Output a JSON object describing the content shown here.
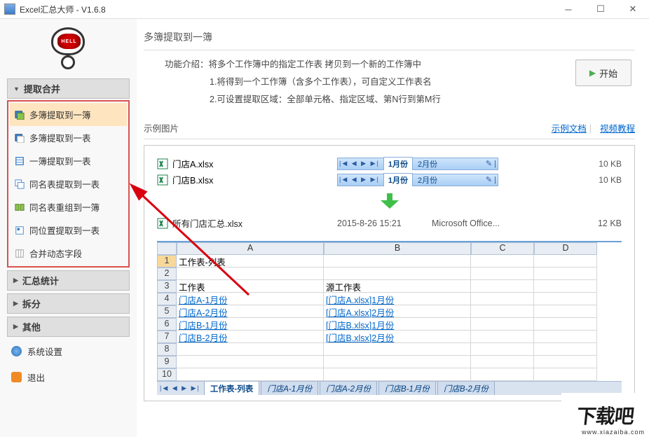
{
  "window": {
    "title": "Excel汇总大师 - V1.6.8"
  },
  "sidebar": {
    "groups": [
      {
        "label": "提取合并",
        "open": true,
        "highlighted": true,
        "items": [
          {
            "label": "多簿提取到一簿",
            "active": true
          },
          {
            "label": "多簿提取到一表"
          },
          {
            "label": "一簿提取到一表"
          },
          {
            "label": "同名表提取到一表"
          },
          {
            "label": "同名表重组到一簿"
          },
          {
            "label": "同位置提取到一表"
          },
          {
            "label": "合并动态字段"
          }
        ]
      },
      {
        "label": "汇总统计"
      },
      {
        "label": "拆分"
      },
      {
        "label": "其他"
      }
    ],
    "system": {
      "settings": "系统设置",
      "exit": "退出"
    },
    "robot_face": "HELL"
  },
  "page": {
    "title": "多簿提取到一簿",
    "intro_label": "功能介绍：",
    "intro_text": "将多个工作簿中的指定工作表 拷贝到一个新的工作簿中",
    "line1": "1.将得到一个工作簿（含多个工作表），可自定义工作表名",
    "line2": "2.可设置提取区域：全部单元格、指定区域、第N行到第M行",
    "start_label": "开始",
    "example_label": "示例图片",
    "example_doc": "示例文档",
    "video_tutorial": "视频教程"
  },
  "preview": {
    "files": [
      {
        "name": "门店A.xlsx",
        "tab1": "1月份",
        "tab2": "2月份",
        "size": "10 KB"
      },
      {
        "name": "门店B.xlsx",
        "tab1": "1月份",
        "tab2": "2月份",
        "size": "10 KB"
      }
    ],
    "result": {
      "name": "所有门店汇总.xlsx",
      "date": "2015-8-26 15:21",
      "type": "Microsoft Office...",
      "size": "12 KB"
    }
  },
  "sheet": {
    "cols": [
      "A",
      "B",
      "C",
      "D"
    ],
    "header1": "工作表-列表",
    "col_a_header": "工作表",
    "col_b_header": "源工作表",
    "rows": [
      {
        "n": "4",
        "a": "门店A-1月份",
        "b": "[门店A.xlsx]1月份"
      },
      {
        "n": "5",
        "a": "门店A-2月份",
        "b": "[门店A.xlsx]2月份"
      },
      {
        "n": "6",
        "a": "门店B-1月份",
        "b": "[门店B.xlsx]1月份"
      },
      {
        "n": "7",
        "a": "门店B-2月份",
        "b": "[门店B.xlsx]2月份"
      }
    ],
    "tabs": [
      "工作表-列表",
      "门店A-1月份",
      "门店A-2月份",
      "门店B-1月份",
      "门店B-2月份"
    ]
  }
}
